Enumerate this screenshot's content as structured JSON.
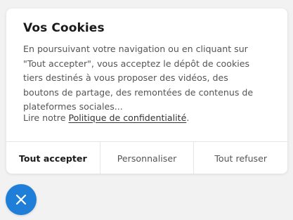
{
  "dialog": {
    "title": "Vos Cookies",
    "description": "En poursuivant votre navigation ou en cliquant sur \"Tout accepter\", vous acceptez le dépôt de cookies tiers destinés à vous proposer des vidéos, des boutons de partage, des remontées de contenus de plateformes sociales...",
    "policy_prefix": "Lire notre ",
    "policy_link": "Politique de confidentialité",
    "policy_suffix": ".",
    "buttons": {
      "accept_all": "Tout accepter",
      "customize": "Personnaliser",
      "refuse_all": "Tout refuser"
    }
  },
  "floating_button": {
    "icon": "close-icon",
    "color": "#1f7fd8"
  }
}
